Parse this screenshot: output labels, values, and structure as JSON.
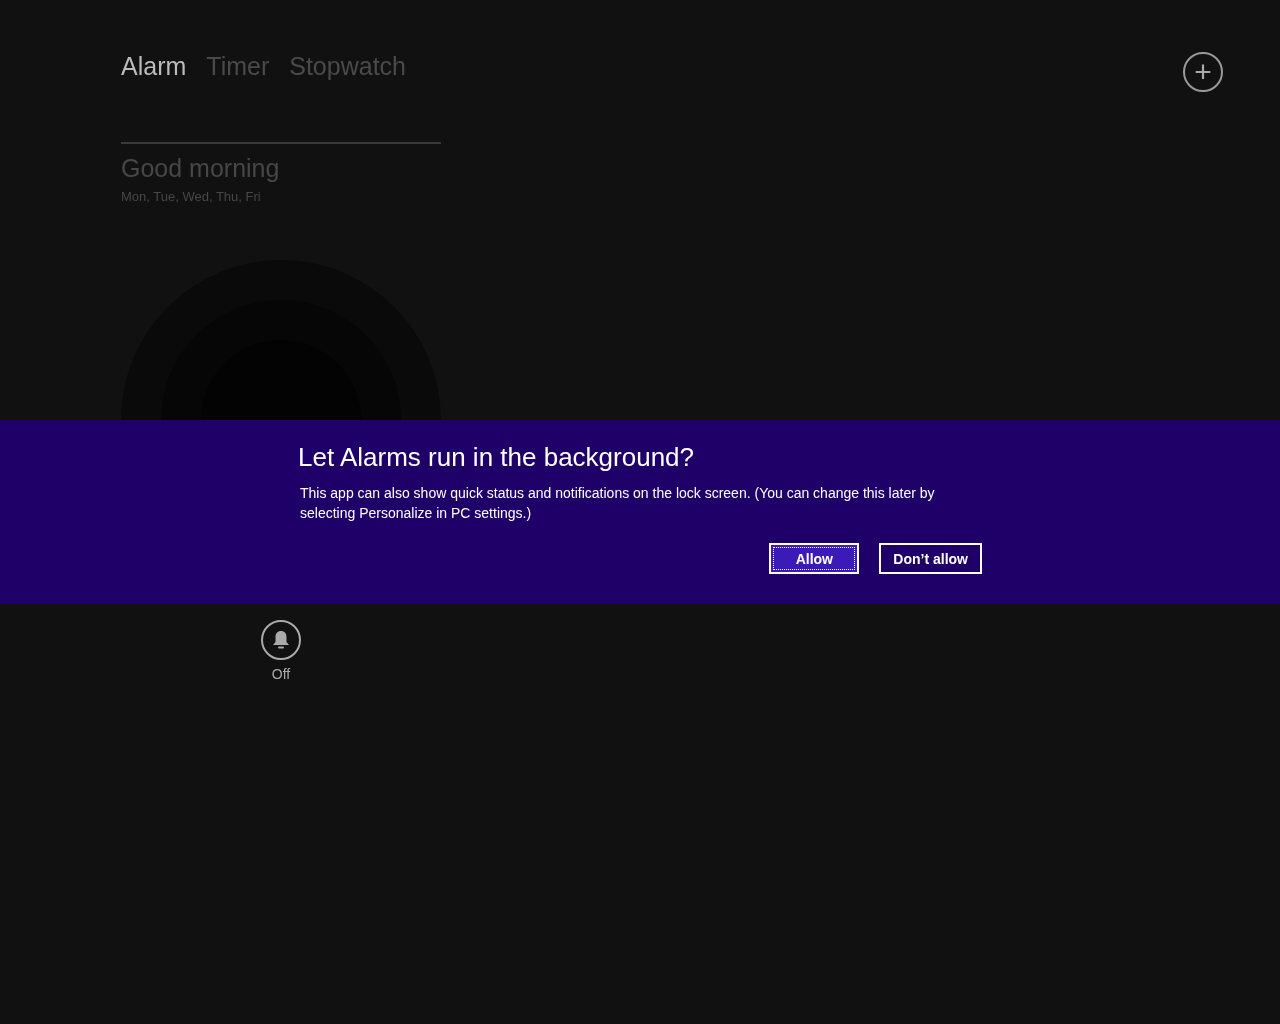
{
  "tabs": [
    {
      "label": "Alarm",
      "selected": true
    },
    {
      "label": "Timer",
      "selected": false
    },
    {
      "label": "Stopwatch",
      "selected": false
    }
  ],
  "add_button": {
    "label": "+"
  },
  "alarm": {
    "name": "Good morning",
    "days": "Mon, Tue, Wed, Thu, Fri",
    "on": false,
    "status": "Off"
  },
  "dialog": {
    "title": "Let Alarms run in the background?",
    "message": "This app can also show quick status and notifications on the lock screen. (You can change this later by selecting Personalize in PC settings.)",
    "buttons": [
      {
        "label": "Allow",
        "focused": true
      },
      {
        "label": "Don’t allow",
        "focused": false
      }
    ]
  }
}
